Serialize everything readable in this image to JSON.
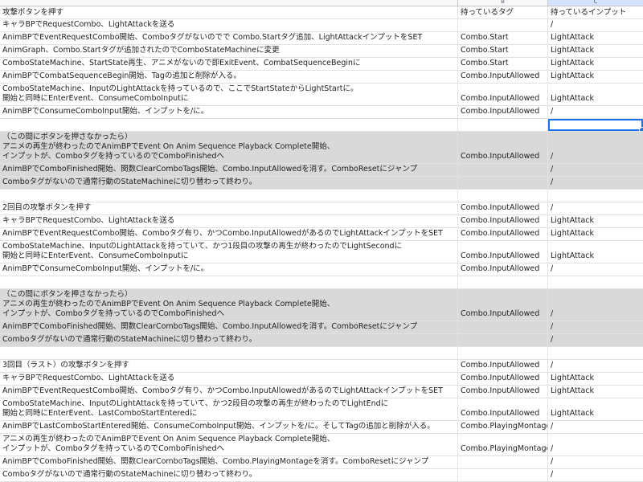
{
  "column_heads": [
    "",
    "B",
    "C"
  ],
  "rows": [
    {
      "a": "攻撃ボタンを押す",
      "b": "持っているタグ",
      "c": "持っているインプット",
      "h": 16,
      "gray": false,
      "va": "mid"
    },
    {
      "a": "キャラBPでRequestCombo、LightAttackを送る",
      "b": "",
      "c": "/",
      "h": 16,
      "gray": false,
      "va": "bottom"
    },
    {
      "a": "AnimBPでEventRequestCombo開始、Comboタグがないのでで Combo.Startタグ追加、LightAttackインプットをSET",
      "b": "Combo.Start",
      "c": "LightAttack",
      "h": 16,
      "gray": false,
      "va": "bottom"
    },
    {
      "a": "AnimGraph、Combo.Startタグが追加されたのでComboStateMachineに変更",
      "b": "Combo.Start",
      "c": "LightAttack",
      "h": 16,
      "gray": false,
      "va": "bottom"
    },
    {
      "a": "ComboStateMachine、StartState再生、アニメがないので即ExitEvent、CombatSequenceBeginに",
      "b": "Combo.Start",
      "c": "LightAttack",
      "h": 16,
      "gray": false,
      "va": "bottom"
    },
    {
      "a": "AnimBPでCombatSequenceBegin開始、Tagの追加と削除が入る。",
      "b": "Combo.InputAllowed",
      "c": "LightAttack",
      "h": 16,
      "gray": false,
      "va": "bottom"
    },
    {
      "a": "ComboStateMachine、InputのLightAttackを持っているので、ここでStartStateからLightStartに。\n開始と同時にEnterEvent、ConsumeComboInputに",
      "b": "Combo.InputAllowed",
      "c": "LightAttack",
      "h": 28,
      "gray": false,
      "va": "bottom"
    },
    {
      "a": "AnimBPでConsumeComboInput開始、インプットを/に。",
      "b": "Combo.InputAllowed",
      "c": "/",
      "h": 16,
      "gray": false,
      "va": "bottom"
    },
    {
      "a": "",
      "b": "",
      "c": "",
      "h": 16,
      "gray": false,
      "va": "bottom",
      "selected": true
    },
    {
      "a": "（この間にボタンを押さなかったら）\nアニメの再生が終わったのでAnimBPでEvent On Anim Sequence Playback Complete開始、\nインプットが、Comboタグを持っているのでComboFinishedへ",
      "b": "Combo.InputAllowed",
      "c": "/",
      "h": 40,
      "gray": true,
      "va": "bottom"
    },
    {
      "a": "AnimBPでComboFinished開始、関数ClearComboTags開始、Combo.InputAllowedを消す。ComboResetにジャンプ",
      "b": "",
      "c": "/",
      "h": 16,
      "gray": true,
      "va": "bottom"
    },
    {
      "a": "Comboタグがないので通常行動のStateMachineに切り替わって終わり。",
      "b": "",
      "c": "/",
      "h": 16,
      "gray": true,
      "va": "bottom"
    },
    {
      "a": "",
      "b": "",
      "c": "",
      "h": 16,
      "gray": false,
      "va": "bottom"
    },
    {
      "a": "2回目の攻撃ボタンを押す",
      "b": "Combo.InputAllowed",
      "c": "/",
      "h": 16,
      "gray": false,
      "va": "bottom"
    },
    {
      "a": "キャラBPでRequestCombo、LightAttackを送る",
      "b": "Combo.InputAllowed",
      "c": "LightAttack",
      "h": 16,
      "gray": false,
      "va": "bottom"
    },
    {
      "a": "AnimBPでEventRequestCombo開始、Comboタグ有り、かつCombo.InputAllowedがあるのでLightAttackインプットをSET",
      "b": "Combo.InputAllowed",
      "c": "LightAttack",
      "h": 16,
      "gray": false,
      "va": "bottom"
    },
    {
      "a": "ComboStateMachine、InputのLightAttackを持っていて、かつ1段目の攻撃の再生が終わったのでLightSecondに\n開始と同時にEnterEvent、ConsumeComboInputに",
      "b": "Combo.InputAllowed",
      "c": "LightAttack",
      "h": 28,
      "gray": false,
      "va": "bottom"
    },
    {
      "a": "AnimBPでConsumeComboInput開始、インプットを/に。",
      "b": "Combo.InputAllowed",
      "c": "/",
      "h": 16,
      "gray": false,
      "va": "bottom"
    },
    {
      "a": "",
      "b": "",
      "c": "",
      "h": 16,
      "gray": false,
      "va": "bottom"
    },
    {
      "a": "（この間にボタンを押さなかったら）\nアニメの再生が終わったのでAnimBPでEvent On Anim Sequence Playback Complete開始、\nインプットが、Comboタグを持っているのでComboFinishedへ",
      "b": "Combo.InputAllowed",
      "c": "/",
      "h": 40,
      "gray": true,
      "va": "bottom"
    },
    {
      "a": "AnimBPでComboFinished開始、関数ClearComboTags開始、Combo.InputAllowedを消す。ComboResetにジャンプ",
      "b": "",
      "c": "/",
      "h": 16,
      "gray": true,
      "va": "bottom"
    },
    {
      "a": "Comboタグがないので通常行動のStateMachineに切り替わって終わり。",
      "b": "",
      "c": "/",
      "h": 16,
      "gray": true,
      "va": "bottom"
    },
    {
      "a": "",
      "b": "",
      "c": "",
      "h": 16,
      "gray": false,
      "va": "bottom"
    },
    {
      "a": "3回目（ラスト）の攻撃ボタンを押す",
      "b": "Combo.InputAllowed",
      "c": "/",
      "h": 16,
      "gray": false,
      "va": "bottom"
    },
    {
      "a": "キャラBPでRequestCombo、LightAttackを送る",
      "b": "Combo.InputAllowed",
      "c": "LightAttack",
      "h": 16,
      "gray": false,
      "va": "bottom"
    },
    {
      "a": "AnimBPでEventRequestCombo開始、Comboタグ有り、かつCombo.InputAllowedがあるのでLightAttackインプットをSET",
      "b": "Combo.InputAllowed",
      "c": "LightAttack",
      "h": 16,
      "gray": false,
      "va": "bottom"
    },
    {
      "a": "ComboStateMachine、InputのLightAttackを持っていて、かつ2段目の攻撃の再生が終わったのでLightEndに\n開始と同時にEnterEvent、LastComboStartEnteredに",
      "b": "Combo.InputAllowed",
      "c": "LightAttack",
      "h": 28,
      "gray": false,
      "va": "bottom"
    },
    {
      "a": "AnimBPでLastComboStartEntered開始、ConsumeComboInput開始、インプットを/に。そしてTagの追加と削除が入る。",
      "b": "Combo.PlayingMontage",
      "c": "/",
      "h": 16,
      "gray": false,
      "va": "bottom"
    },
    {
      "a": "アニメの再生が終わったのでAnimBPでEvent On Anim Sequence Playback Complete開始、\nインプットが、Comboタグを持っているのでComboFinishedへ",
      "b": "Combo.PlayingMontage",
      "c": "/",
      "h": 28,
      "gray": false,
      "va": "bottom"
    },
    {
      "a": "AnimBPでComboFinished開始、関数ClearComboTags開始、Combo.PlayingMontageを消す。ComboResetにジャンプ",
      "b": "",
      "c": "/",
      "h": 16,
      "gray": false,
      "va": "bottom"
    },
    {
      "a": "Comboタグがないので通常行動のStateMachineに切り替わって終わり。",
      "b": "",
      "c": "/",
      "h": 16,
      "gray": false,
      "va": "bottom"
    }
  ]
}
